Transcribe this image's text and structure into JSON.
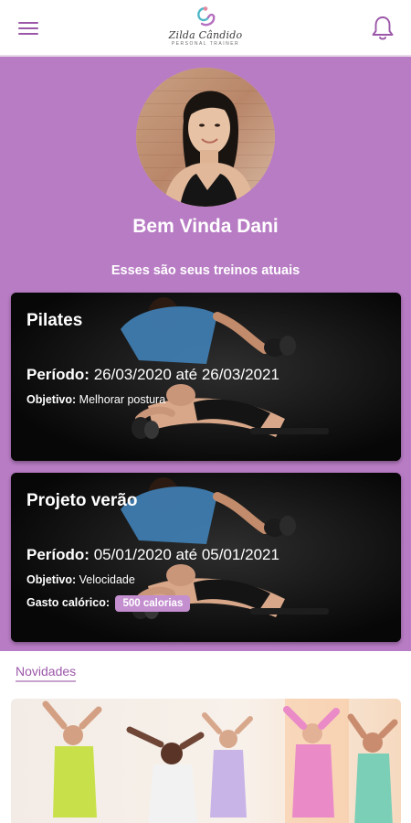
{
  "header": {
    "menu_icon": "hamburger-menu-icon",
    "logo": {
      "name": "Zilda Cândido",
      "subtitle": "PERSONAL TRAINER"
    },
    "bell_icon": "bell-icon"
  },
  "colors": {
    "brand_purple": "#b87cc4",
    "accent": "#9b57a8",
    "badge": "#c48fcf"
  },
  "profile": {
    "greeting": "Bem Vinda Dani"
  },
  "workouts_heading": "Esses são seus treinos atuais",
  "workouts": [
    {
      "title": "Pilates",
      "period_label": "Período:",
      "period_value": "26/03/2020 até 26/03/2021",
      "goal_label": "Objetivo:",
      "goal_value": "Melhorar postura"
    },
    {
      "title": "Projeto verão",
      "period_label": "Período:",
      "period_value": "05/01/2020 até 05/01/2021",
      "goal_label": "Objetivo:",
      "goal_value": "Velocidade",
      "calories_label": "Gasto calórico:",
      "calories_value": "500 calorias"
    }
  ],
  "news": {
    "label": "Novidades"
  }
}
